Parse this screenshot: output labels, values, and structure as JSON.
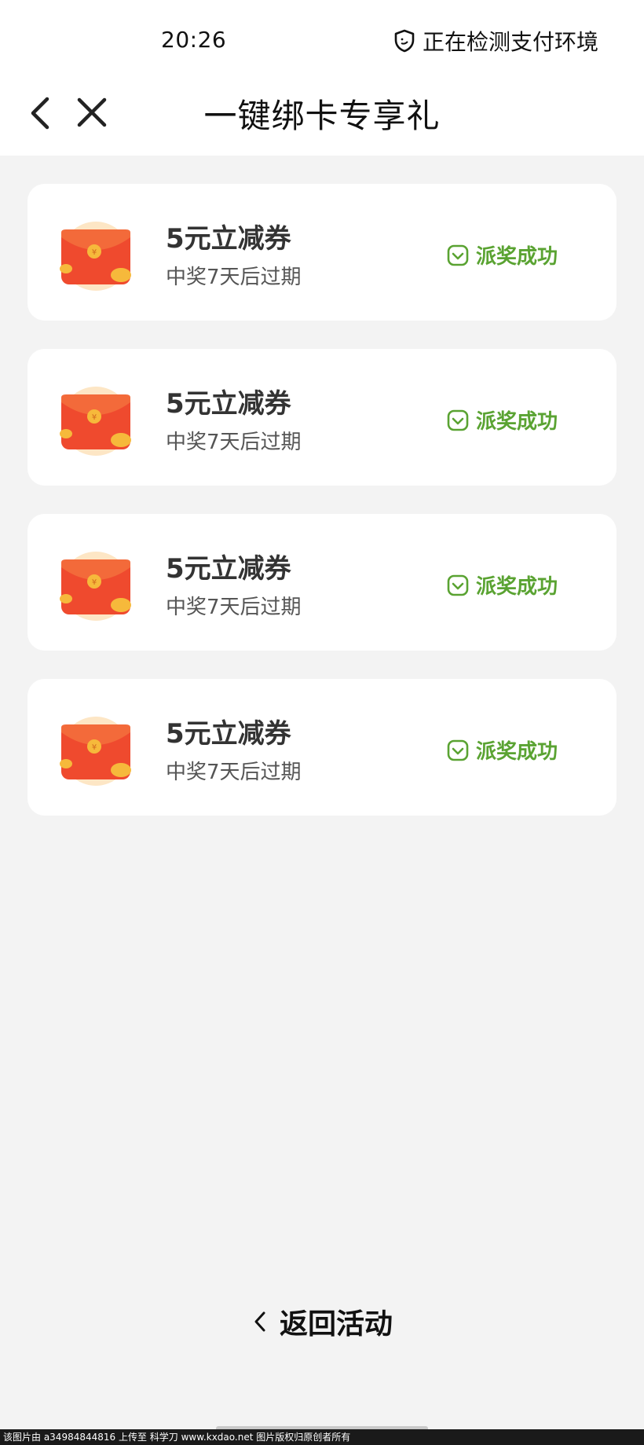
{
  "status_bar": {
    "time": "20:26",
    "security_text": "正在检测支付环境",
    "security_icon": "shield-icon"
  },
  "header": {
    "title": "一键绑卡专享礼",
    "back_icon": "chevron-left-icon",
    "close_icon": "close-icon"
  },
  "rewards": [
    {
      "title": "5元立减券",
      "subtitle": "中奖7天后过期",
      "status": "派奖成功"
    },
    {
      "title": "5元立减券",
      "subtitle": "中奖7天后过期",
      "status": "派奖成功"
    },
    {
      "title": "5元立减券",
      "subtitle": "中奖7天后过期",
      "status": "派奖成功"
    },
    {
      "title": "5元立减券",
      "subtitle": "中奖7天后过期",
      "status": "派奖成功"
    }
  ],
  "footer": {
    "back_label": "返回活动",
    "watermark": "该图片由 a34984844816 上传至 科学刀 www.kxdao.net 图片版权归原创者所有"
  },
  "colors": {
    "success": "#5aa332",
    "envelope_red": "#ef4a2e",
    "coin_gold": "#f6b93b",
    "background": "#f3f3f3"
  }
}
